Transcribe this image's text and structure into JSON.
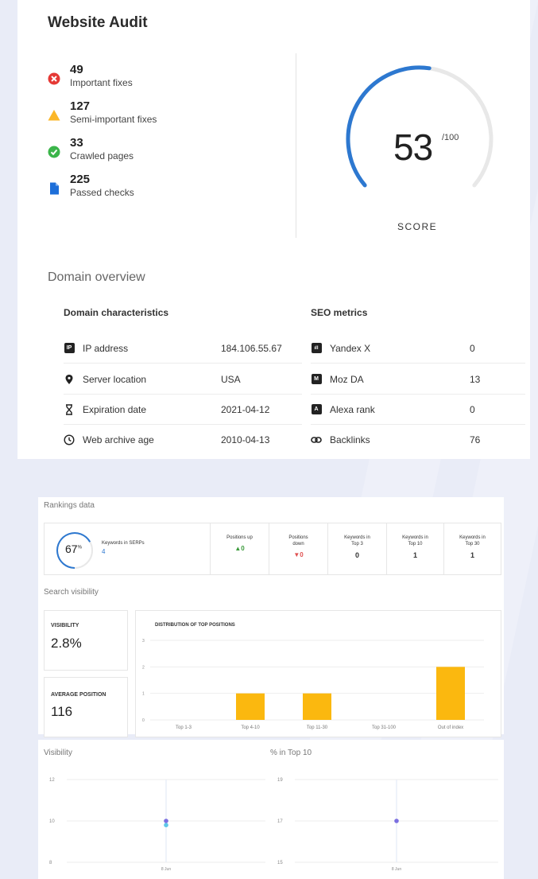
{
  "audit": {
    "title": "Website Audit",
    "stats": [
      {
        "value": "49",
        "label": "Important fixes",
        "icon": "error-icon",
        "color": "#e53935"
      },
      {
        "value": "127",
        "label": "Semi-important fixes",
        "icon": "warning-icon",
        "color": "#fbb728"
      },
      {
        "value": "33",
        "label": "Crawled pages",
        "icon": "check-icon",
        "color": "#3bb54a"
      },
      {
        "value": "225",
        "label": "Passed checks",
        "icon": "document-icon",
        "color": "#1e6fd9"
      }
    ],
    "score": {
      "value": "53",
      "max": "/100",
      "label": "SCORE",
      "fraction": 0.53,
      "color": "#2d78d0"
    }
  },
  "domain": {
    "title": "Domain overview",
    "characteristics": {
      "heading": "Domain characteristics",
      "rows": [
        {
          "label": "IP address",
          "value": "184.106.55.67",
          "icon": "ip-icon"
        },
        {
          "label": "Server location",
          "value": "USA",
          "icon": "location-pin-icon"
        },
        {
          "label": "Expiration date",
          "value": "2021-04-12",
          "icon": "hourglass-icon"
        },
        {
          "label": "Web archive age",
          "value": "2010-04-13",
          "icon": "clock-icon"
        }
      ]
    },
    "seo": {
      "heading": "SEO metrics",
      "rows": [
        {
          "label": "Yandex X",
          "value": "0",
          "icon": "yandex-icon"
        },
        {
          "label": "Moz DA",
          "value": "13",
          "icon": "moz-icon"
        },
        {
          "label": "Alexa rank",
          "value": "0",
          "icon": "alexa-icon"
        },
        {
          "label": "Backlinks",
          "value": "76",
          "icon": "link-icon"
        }
      ]
    }
  },
  "rankings": {
    "title": "Rankings data",
    "keywords_pct": "67",
    "keywords_pct_unit": "%",
    "keywords_fraction": 0.67,
    "keywords_label": "Keywords in SERPs",
    "keywords_count": "4",
    "cells": [
      {
        "label": "Positions up",
        "value": "0",
        "arrow": "▲",
        "color": "#3a9a3a"
      },
      {
        "label": "Positions down",
        "value": "0",
        "arrow": "▼",
        "color": "#e05050"
      },
      {
        "label": "Keywords in Top 3",
        "value": "0",
        "arrow": "",
        "color": "#222"
      },
      {
        "label": "Keywords in Top 10",
        "value": "1",
        "arrow": "",
        "color": "#222"
      },
      {
        "label": "Keywords in Top 30",
        "value": "1",
        "arrow": "",
        "color": "#222"
      }
    ]
  },
  "search_visibility": {
    "title": "Search visibility",
    "visibility_label": "VISIBILITY",
    "visibility_value": "2.8%",
    "avg_label": "AVERAGE POSITION",
    "avg_value": "116"
  },
  "chart_data": [
    {
      "type": "bar",
      "title": "DISTRIBUTION OF TOP POSITIONS",
      "categories": [
        "Top 1-3",
        "Top 4-10",
        "Top 11-30",
        "Top 31-100",
        "Out of index"
      ],
      "values": [
        0,
        1,
        1,
        0,
        2
      ],
      "yticks": [
        0,
        1,
        2,
        3
      ],
      "ylim": [
        0,
        3
      ],
      "color": "#fbb80f",
      "grid": true
    },
    {
      "type": "scatter",
      "title": "Visibility",
      "x": [
        "8 Jun"
      ],
      "series": [
        {
          "values": [
            10
          ],
          "color": "#7b6fe0"
        },
        {
          "values": [
            9.8
          ],
          "color": "#5ec6e8"
        }
      ],
      "yticks": [
        8,
        10,
        12
      ],
      "ylim": [
        8,
        12
      ],
      "grid": true
    },
    {
      "type": "scatter",
      "title": "% in Top 10",
      "x": [
        "8 Jun"
      ],
      "series": [
        {
          "values": [
            17
          ],
          "color": "#7b6fe0"
        }
      ],
      "yticks": [
        15,
        17,
        19
      ],
      "ylim": [
        15,
        19
      ],
      "grid": true
    }
  ]
}
